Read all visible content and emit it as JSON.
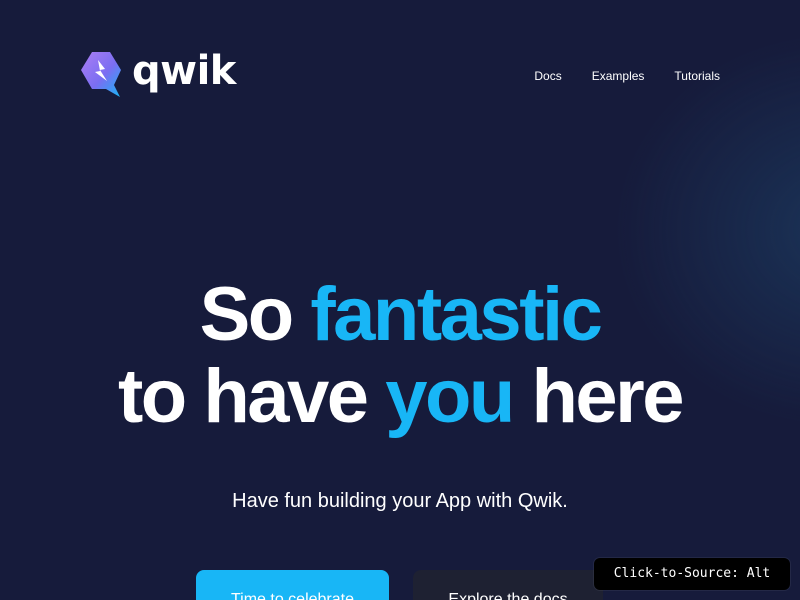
{
  "brand": {
    "name": "qwik",
    "logo_icon": "qwik-logo-icon"
  },
  "nav": [
    {
      "label": "Docs"
    },
    {
      "label": "Examples"
    },
    {
      "label": "Tutorials"
    }
  ],
  "hero": {
    "line1_plain": "So",
    "line1_accent": "fantastic",
    "line2_start": "to have",
    "line2_accent": "you",
    "line2_end": "here",
    "subtitle": "Have fun building your App with Qwik."
  },
  "buttons": {
    "primary_label": "Time to celebrate",
    "secondary_label": "Explore the docs"
  },
  "overlay": {
    "label": "Click-to-Source: Alt"
  },
  "colors": {
    "background": "#161b3b",
    "accent": "#18b6f6",
    "secondary_button": "#1e2132",
    "logo_purple": "#ac7ef4",
    "logo_blue": "#18b6f6"
  }
}
